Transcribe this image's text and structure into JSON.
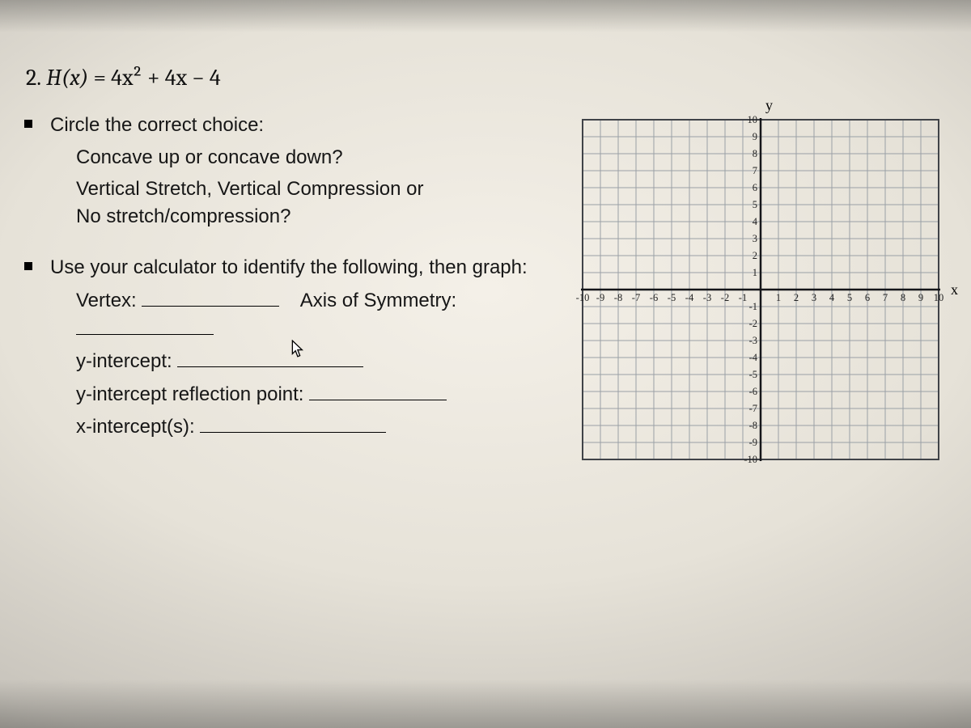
{
  "problem": {
    "number": "2.",
    "func_lhs": "H(x)",
    "func_rhs": "= 4x² + 4x − 4"
  },
  "bullet1": {
    "prompt": "Circle the correct choice:",
    "choice_a": "Concave up or concave down?",
    "choice_b": "Vertical Stretch, Vertical Compression or No stretch/compression?"
  },
  "bullet2": {
    "prompt": "Use your calculator to identify the following, then graph:",
    "vertex_label": "Vertex:",
    "aos_label": "Axis of Symmetry:",
    "yint_label": "y-intercept:",
    "yreflect_label": "y-intercept reflection point:",
    "xint_label": "x-intercept(s):"
  },
  "graph": {
    "y_label": "y",
    "x_label": "x",
    "x_ticks_neg": [
      "-10",
      "-9",
      "-8",
      "-7",
      "-6",
      "-5",
      "-4",
      "-3",
      "-2",
      "-1"
    ],
    "x_ticks_pos": [
      "1",
      "2",
      "3",
      "4",
      "5",
      "6",
      "7",
      "8",
      "9",
      "10"
    ],
    "y_ticks_pos": [
      "10",
      "9",
      "8",
      "7",
      "6",
      "5",
      "4",
      "3",
      "2",
      "1"
    ],
    "y_ticks_neg": [
      "-1",
      "-2",
      "-3",
      "-4",
      "-5",
      "-6",
      "-7",
      "-8",
      "-9",
      "-10"
    ]
  },
  "chart_data": {
    "type": "scatter",
    "title": "",
    "xlabel": "x",
    "ylabel": "y",
    "xlim": [
      -10,
      10
    ],
    "ylim": [
      -10,
      10
    ],
    "grid": true,
    "series": [
      {
        "name": "H(x)",
        "x": [],
        "y": []
      }
    ],
    "notes": "Blank coordinate grid with unit gridlines; no data points plotted."
  }
}
